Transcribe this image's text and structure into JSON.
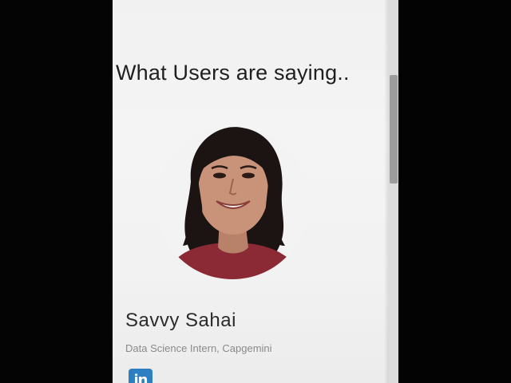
{
  "testimonials": {
    "heading": "What Users are saying..",
    "user": {
      "name": "Savvy Sahai",
      "role": "Data Science Intern, Capgemini",
      "social_icon": "linkedin-icon",
      "social_label": "in"
    }
  },
  "colors": {
    "page_background": "#f2f2f2",
    "heading_text": "#1f1f1f",
    "role_text": "#8a8a8a",
    "linkedin_blue": "#2d7fc1",
    "shirt_maroon": "#8b2a35",
    "bezel": "#000000"
  }
}
